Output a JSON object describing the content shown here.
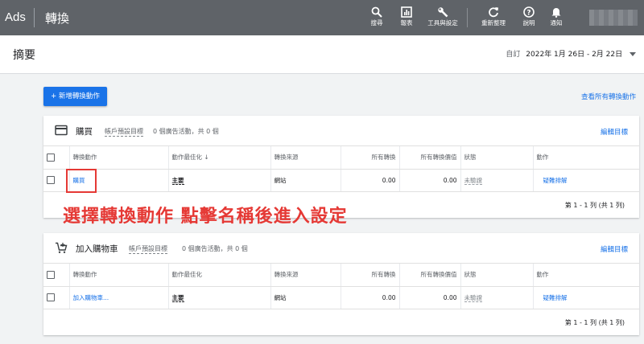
{
  "app": {
    "brand": "Ads",
    "page_title": "轉換"
  },
  "toolbar": {
    "search_label": "搜尋",
    "reports_label": "報表",
    "tools_label": "工具與設定",
    "refresh_label": "重新整理",
    "help_label": "說明",
    "notifications_label": "通知"
  },
  "subbar": {
    "title": "摘要",
    "date_label": "自訂",
    "date_range": "2022年 1月 26日 - 2月 22日"
  },
  "actions": {
    "new_button": "+ 新增轉換動作",
    "view_all": "查看所有轉換動作"
  },
  "columns": {
    "action": "轉換動作",
    "optimization": "動作最佳化",
    "source": "轉換來源",
    "all_conv": "所有轉換",
    "all_conv_value": "所有轉換價值",
    "status": "狀態",
    "act": "動作"
  },
  "cards": [
    {
      "title": "購買",
      "goal": "帳戶預設目標",
      "stats": "0 個廣告活動，共 0 個",
      "edit": "編輯目標",
      "row": {
        "name": "購買",
        "optimization": "主要",
        "source": "網站",
        "all_conv": "0.00",
        "all_conv_value": "0.00",
        "status": "未驗證",
        "action": "疑難排解"
      },
      "pager": "第 1 - 1 列 (共 1 列)"
    },
    {
      "title": "加入購物車",
      "goal": "帳戶預設目標",
      "stats": "0 個廣告活動，共 0 個",
      "edit": "編輯目標",
      "row": {
        "name": "加入購物車...",
        "optimization": "主要",
        "source": "網站",
        "all_conv": "0.00",
        "all_conv_value": "0.00",
        "status": "未驗證",
        "action": "疑難排解"
      },
      "pager": "第 1 - 1 列 (共 1 列)"
    }
  ],
  "annotation": "選擇轉換動作 點擊名稱後進入設定",
  "colors": {
    "topbar": "#5f6368",
    "accent": "#1a73e8",
    "annotation": "#e53935"
  }
}
